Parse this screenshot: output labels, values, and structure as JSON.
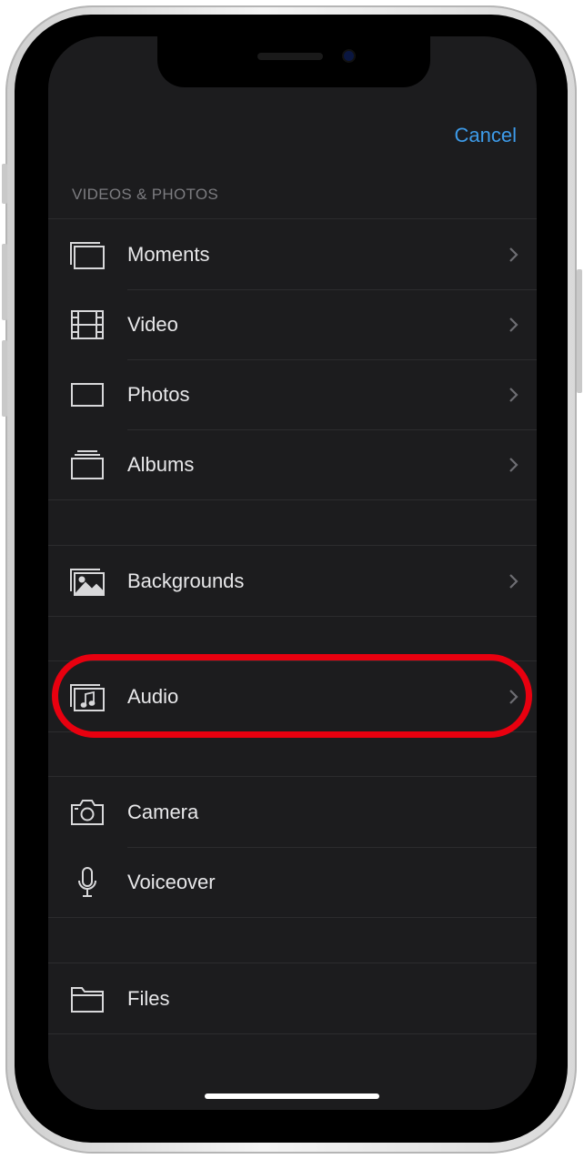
{
  "header": {
    "cancel_label": "Cancel"
  },
  "sections": {
    "videos_photos": {
      "header": "VIDEOS & PHOTOS",
      "items": [
        {
          "label": "Moments",
          "icon": "moments-icon"
        },
        {
          "label": "Video",
          "icon": "film-icon"
        },
        {
          "label": "Photos",
          "icon": "photo-frame-icon"
        },
        {
          "label": "Albums",
          "icon": "albums-icon"
        }
      ]
    },
    "backgrounds": {
      "items": [
        {
          "label": "Backgrounds",
          "icon": "backgrounds-icon"
        }
      ]
    },
    "audio": {
      "items": [
        {
          "label": "Audio",
          "icon": "music-note-icon"
        }
      ]
    },
    "capture": {
      "items": [
        {
          "label": "Camera",
          "icon": "camera-icon"
        },
        {
          "label": "Voiceover",
          "icon": "microphone-icon"
        }
      ]
    },
    "files": {
      "items": [
        {
          "label": "Files",
          "icon": "folder-icon"
        }
      ]
    }
  },
  "colors": {
    "background": "#1c1c1e",
    "accent": "#3d9be9",
    "highlight_ring": "#e8000f"
  }
}
